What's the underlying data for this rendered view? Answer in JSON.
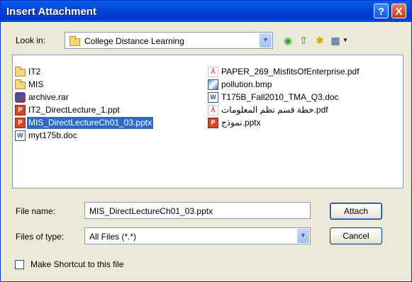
{
  "window": {
    "title": "Insert Attachment"
  },
  "titlebar_buttons": {
    "help": "?",
    "close": "X"
  },
  "lookin": {
    "label": "Look in:",
    "value": "College Distance Learning"
  },
  "files_left": [
    {
      "name": "IT2",
      "icon": "folder-icon"
    },
    {
      "name": "MIS",
      "icon": "folder-icon"
    },
    {
      "name": "archive.rar",
      "icon": "rar-icon"
    },
    {
      "name": "IT2_DirectLecture_1.ppt",
      "icon": "ppt-icon"
    },
    {
      "name": "MIS_DirectLectureCh01_03.pptx",
      "icon": "ppt-icon",
      "selected": true
    },
    {
      "name": "myt175b.doc",
      "icon": "word-doc-icon"
    }
  ],
  "files_right": [
    {
      "name": "PAPER_269_MisfitsOfEnterprise.pdf",
      "icon": "pdf-icon"
    },
    {
      "name": "pollution.bmp",
      "icon": "bmp-icon"
    },
    {
      "name": "T175B_Fall2010_TMA_Q3.doc",
      "icon": "word-doc-icon"
    },
    {
      "name": "خطة قسم نظم المعلومات.pdf",
      "icon": "pdf-icon"
    },
    {
      "name": "نموذج.pptx",
      "icon": "ppt-icon"
    }
  ],
  "filename": {
    "label": "File name:",
    "value": "MIS_DirectLectureCh01_03.pptx"
  },
  "filetype": {
    "label": "Files of type:",
    "value": "All Files (*.*)"
  },
  "buttons": {
    "attach": "Attach",
    "cancel": "Cancel"
  },
  "shortcut": {
    "label": "Make Shortcut to this file",
    "checked": false
  }
}
